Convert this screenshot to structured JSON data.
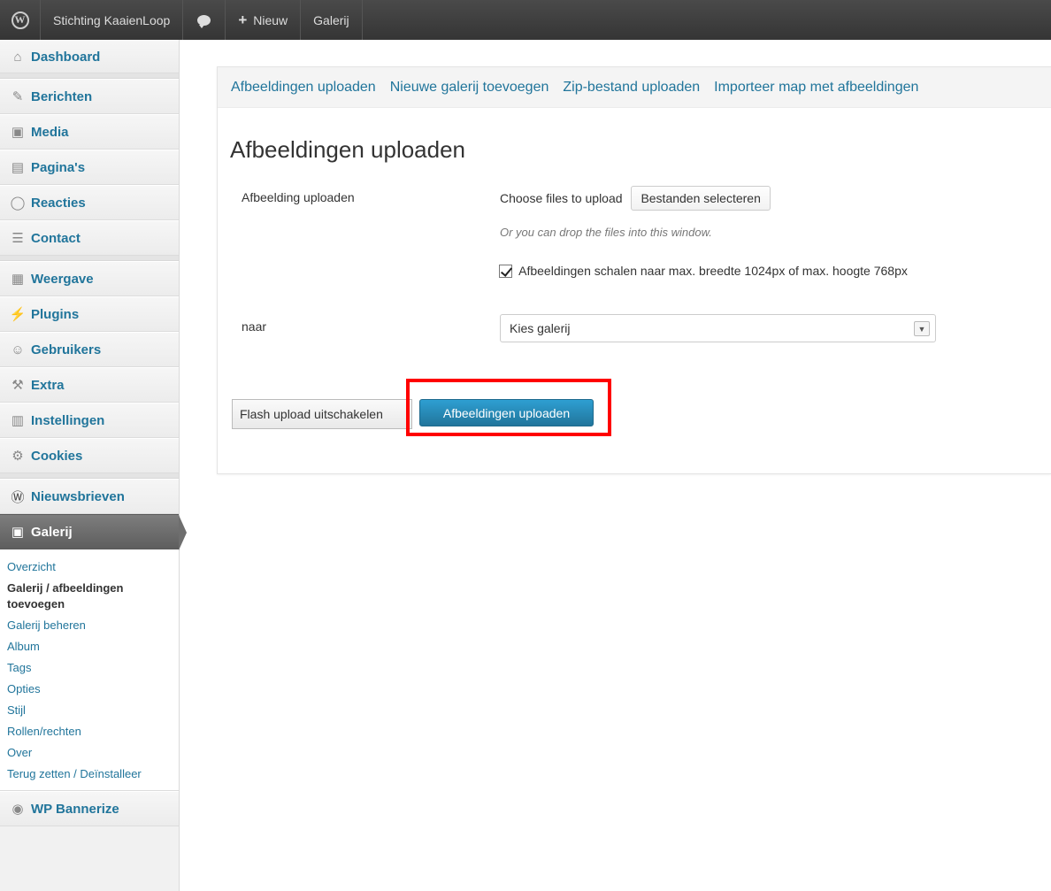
{
  "adminbar": {
    "site_name": "Stichting KaaienLoop",
    "new_label": "Nieuw",
    "gallery_label": "Galerij"
  },
  "sidebar": {
    "items": [
      {
        "label": "Dashboard",
        "icon": "house-icon"
      },
      {
        "label": "Berichten",
        "icon": "pushpin-icon"
      },
      {
        "label": "Media",
        "icon": "camera-icon"
      },
      {
        "label": "Pagina's",
        "icon": "pages-icon"
      },
      {
        "label": "Reacties",
        "icon": "speech-bubble-icon"
      },
      {
        "label": "Contact",
        "icon": "contact-form-icon"
      },
      {
        "label": "Weergave",
        "icon": "layout-icon"
      },
      {
        "label": "Plugins",
        "icon": "plug-icon"
      },
      {
        "label": "Gebruikers",
        "icon": "users-icon"
      },
      {
        "label": "Extra",
        "icon": "tools-icon"
      },
      {
        "label": "Instellingen",
        "icon": "sliders-icon"
      },
      {
        "label": "Cookies",
        "icon": "gear-icon"
      },
      {
        "label": "Nieuwsbrieven",
        "icon": "wordpress-icon"
      },
      {
        "label": "Galerij",
        "icon": "gallery-icon"
      },
      {
        "label": "WP Bannerize",
        "icon": "globe-icon"
      }
    ],
    "submenu": [
      {
        "label": "Overzicht"
      },
      {
        "label": "Galerij / afbeeldingen toevoegen"
      },
      {
        "label": "Galerij beheren"
      },
      {
        "label": "Album"
      },
      {
        "label": "Tags"
      },
      {
        "label": "Opties"
      },
      {
        "label": "Stijl"
      },
      {
        "label": "Rollen/rechten"
      },
      {
        "label": "Over"
      },
      {
        "label": "Terug zetten / Deïnstalleer"
      }
    ]
  },
  "tabs": [
    {
      "label": "Afbeeldingen uploaden"
    },
    {
      "label": "Nieuwe galerij toevoegen"
    },
    {
      "label": "Zip-bestand uploaden"
    },
    {
      "label": "Importeer map met afbeeldingen"
    }
  ],
  "page": {
    "title": "Afbeeldingen uploaden",
    "upload_label": "Afbeelding uploaden",
    "choose_files_text": "Choose files to upload",
    "select_files_button": "Bestanden selecteren",
    "drop_hint": "Or you can drop the files into this window.",
    "resize_checkbox_label": "Afbeeldingen schalen naar max. breedte 1024px of max. hoogte 768px",
    "to_label": "naar",
    "gallery_select_value": "Kies galerij",
    "flash_button": "Flash upload uitschakelen",
    "upload_button": "Afbeeldingen uploaden"
  },
  "colors": {
    "link": "#21759b",
    "primary_button": "#2e9fd2",
    "highlight": "#ff0000"
  }
}
